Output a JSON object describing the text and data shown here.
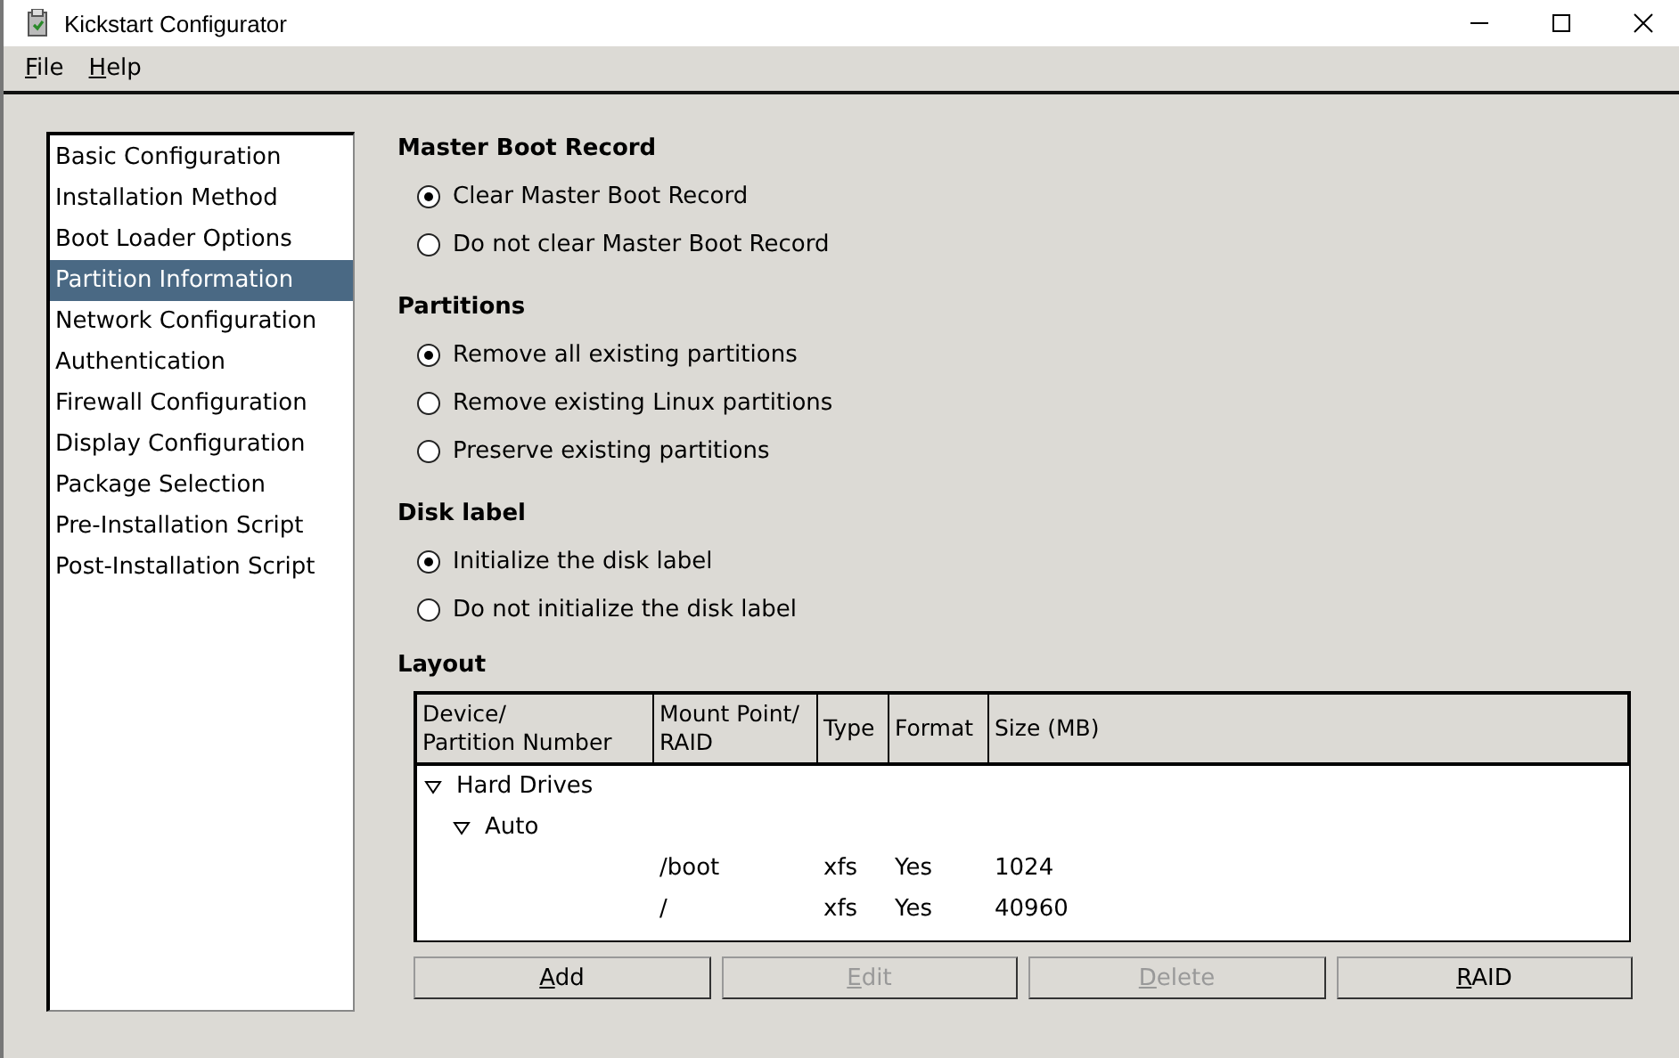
{
  "window": {
    "title": "Kickstart Configurator"
  },
  "menu": [
    "File",
    "Help"
  ],
  "sidebar": {
    "items": [
      {
        "label": "Basic Configuration",
        "selected": false
      },
      {
        "label": "Installation Method",
        "selected": false
      },
      {
        "label": "Boot Loader Options",
        "selected": false
      },
      {
        "label": "Partition Information",
        "selected": true
      },
      {
        "label": "Network Configuration",
        "selected": false
      },
      {
        "label": "Authentication",
        "selected": false
      },
      {
        "label": "Firewall Configuration",
        "selected": false
      },
      {
        "label": "Display Configuration",
        "selected": false
      },
      {
        "label": "Package Selection",
        "selected": false
      },
      {
        "label": "Pre-Installation Script",
        "selected": false
      },
      {
        "label": "Post-Installation Script",
        "selected": false
      }
    ]
  },
  "groups": [
    {
      "title": "Master Boot Record",
      "options": [
        {
          "label": "Clear Master Boot Record",
          "selected": true
        },
        {
          "label": "Do not clear Master Boot Record",
          "selected": false
        }
      ]
    },
    {
      "title": "Partitions",
      "options": [
        {
          "label": "Remove all existing partitions",
          "selected": true
        },
        {
          "label": "Remove existing Linux partitions",
          "selected": false
        },
        {
          "label": "Preserve existing partitions",
          "selected": false
        }
      ]
    },
    {
      "title": "Disk label",
      "options": [
        {
          "label": "Initialize the disk label",
          "selected": true
        },
        {
          "label": "Do not initialize the disk label",
          "selected": false
        }
      ]
    }
  ],
  "layout": {
    "title": "Layout",
    "columns": [
      "Device/\nPartition Number",
      "Mount Point/\nRAID",
      "Type",
      "Format",
      "Size (MB)"
    ],
    "tree": [
      {
        "label": "Hard Drives",
        "expanded": true,
        "children": [
          {
            "label": "Auto",
            "expanded": true,
            "children": [
              {
                "mount": "/boot",
                "type": "xfs",
                "format": "Yes",
                "size": "1024"
              },
              {
                "mount": "/",
                "type": "xfs",
                "format": "Yes",
                "size": "40960"
              }
            ]
          }
        ]
      }
    ],
    "buttons": [
      {
        "label": "Add",
        "disabled": false
      },
      {
        "label": "Edit",
        "disabled": true
      },
      {
        "label": "Delete",
        "disabled": true
      },
      {
        "label": "RAID",
        "disabled": false
      }
    ]
  }
}
